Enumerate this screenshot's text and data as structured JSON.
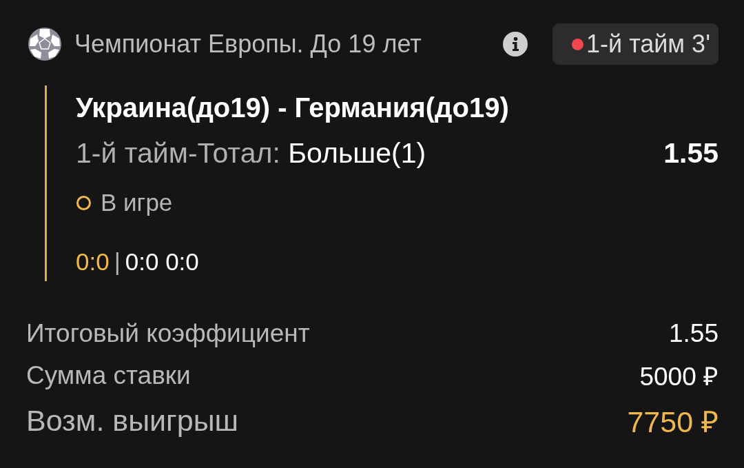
{
  "header": {
    "tournament": "Чемпионат Европы. До 19 лет",
    "period_badge": {
      "text": "1-й тайм 3'",
      "live": true
    }
  },
  "bet": {
    "match": "Украина(до19) - Германия(до19)",
    "market": {
      "label": "1-й тайм-Тотал:",
      "pick": "Больше(1)",
      "odds": "1.55"
    },
    "status": {
      "label": "В игре"
    },
    "score": {
      "current": "0:0",
      "separator": "|",
      "periods": "0:0 0:0"
    }
  },
  "summary": [
    {
      "label": "Итоговый коэффициент",
      "value": "1.55",
      "highlight": false,
      "kind": "normal"
    },
    {
      "label": "Сумма ставки",
      "value": "5000 ₽",
      "highlight": false,
      "kind": "normal"
    },
    {
      "label": "Возм. выигрыш",
      "value": "7750 ₽",
      "highlight": true,
      "kind": "large"
    }
  ]
}
